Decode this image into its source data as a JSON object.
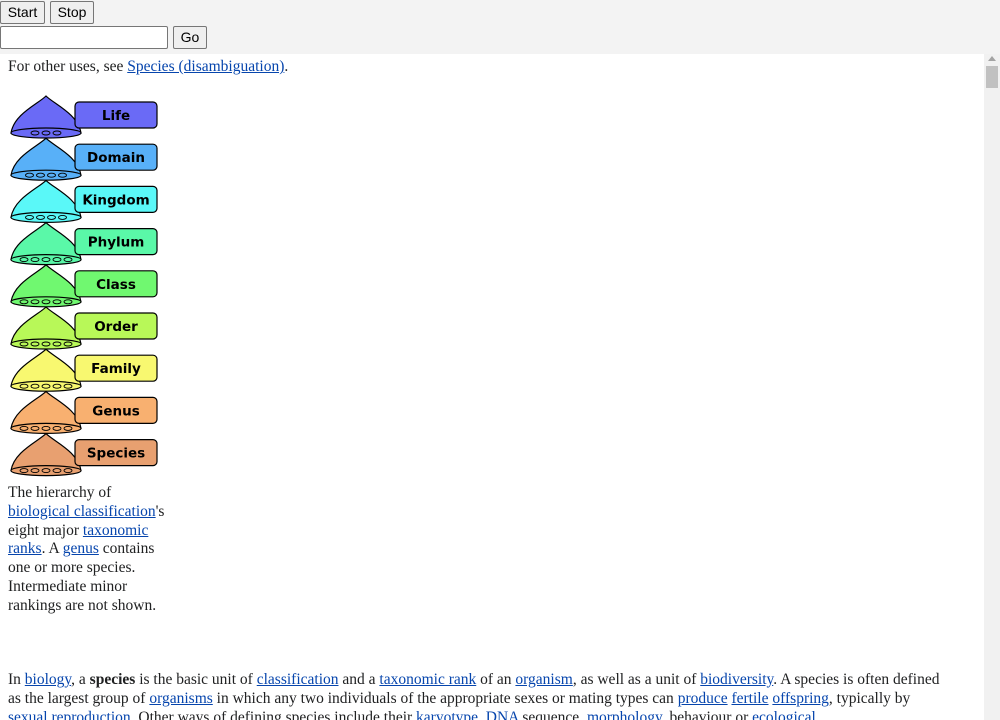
{
  "toolbar": {
    "start_label": "Start",
    "stop_label": "Stop",
    "go_label": "Go",
    "url_value": ""
  },
  "hatnote": {
    "prefix": "For other uses, see ",
    "link": "Species (disambiguation)",
    "suffix": "."
  },
  "taxonomy": {
    "ranks": [
      "Life",
      "Domain",
      "Kingdom",
      "Phylum",
      "Class",
      "Order",
      "Family",
      "Genus",
      "Species"
    ],
    "colors": [
      "#6a6af6",
      "#58b0f8",
      "#5af8f8",
      "#5af8a8",
      "#70f870",
      "#b8f858",
      "#f8f870",
      "#f8b070",
      "#e8a070"
    ]
  },
  "caption": {
    "t1": "The hierarchy of ",
    "l1": "biological classification",
    "t2": "'s eight major ",
    "l2": "taxonomic ranks",
    "t3": ". A ",
    "l3": "genus",
    "t4": " contains one or more species. Intermediate minor rankings are not shown."
  },
  "intro": {
    "t1": "In ",
    "l1": "biology",
    "t2": ", a ",
    "b1": "species",
    "t3": " is the basic unit of ",
    "l2": "classification",
    "t4": " and a ",
    "l3": "taxonomic rank",
    "t5": " of an ",
    "l4": "organism",
    "t6": ", as well as a unit of ",
    "l5": "biodiversity",
    "t7": ". A species is often defined as the largest group of ",
    "l6": "organisms",
    "t8": " in which any two individuals of the appropriate sexes or mating types can ",
    "l7": "produce",
    "t9": " ",
    "l8": "fertile",
    "t10": " ",
    "l9": "offspring",
    "t11": ", typically by ",
    "l10": "sexual reproduction",
    "t12": ". Other ways of defining species include their ",
    "l11": "karyotype",
    "t13": ", ",
    "l12": "DNA",
    "t14": " sequence, ",
    "l13": "morphology",
    "t15": ", behaviour or ",
    "l14": "ecological"
  }
}
